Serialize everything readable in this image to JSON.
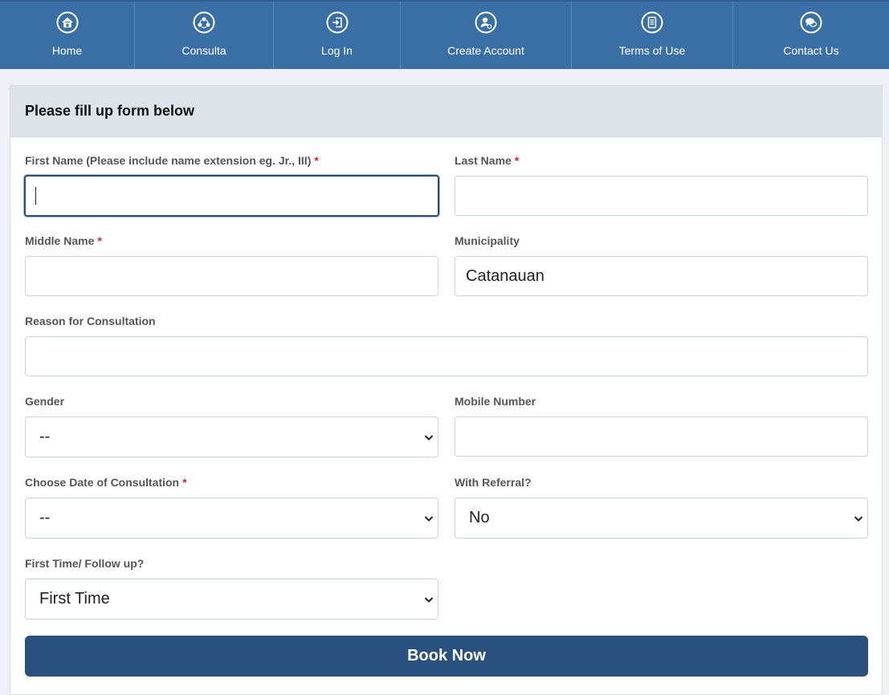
{
  "nav": {
    "items": [
      {
        "label": "Home",
        "icon": "home-icon"
      },
      {
        "label": "Consulta",
        "icon": "consulta-icon"
      },
      {
        "label": "Log In",
        "icon": "login-icon"
      },
      {
        "label": "Create Account",
        "icon": "user-add-icon"
      },
      {
        "label": "Terms of Use",
        "icon": "document-icon"
      },
      {
        "label": "Contact Us",
        "icon": "chat-icon"
      }
    ]
  },
  "form": {
    "header": "Please fill up form below",
    "required_mark": "*",
    "first_name": {
      "label": "First Name (Please include name extension eg. Jr., III)",
      "value": ""
    },
    "last_name": {
      "label": "Last Name",
      "value": ""
    },
    "middle_name": {
      "label": "Middle Name",
      "value": ""
    },
    "municipality": {
      "label": "Municipality",
      "value": "Catanauan"
    },
    "reason": {
      "label": "Reason for Consultation",
      "value": ""
    },
    "gender": {
      "label": "Gender",
      "selected": "--"
    },
    "mobile": {
      "label": "Mobile Number",
      "value": ""
    },
    "date": {
      "label": "Choose Date of Consultation",
      "selected": "--"
    },
    "referral": {
      "label": "With Referral?",
      "selected": "No"
    },
    "visit_type": {
      "label": "First Time/ Follow up?",
      "selected": "First Time"
    },
    "submit_label": "Book Now"
  },
  "colors": {
    "navbar": "#3a6fa5",
    "button": "#2a5080",
    "required": "#d9232d"
  }
}
